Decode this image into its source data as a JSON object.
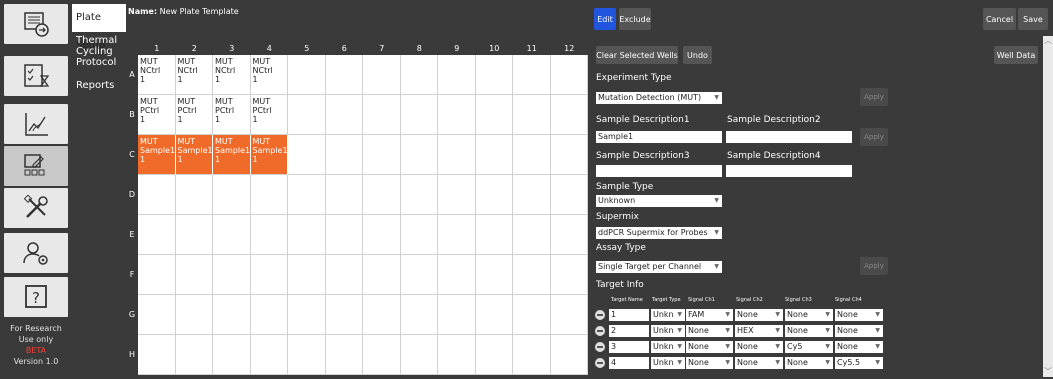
{
  "rail": {
    "nav_icons": [
      "plate-file-icon",
      "checklist-timer-icon",
      "line-chart-icon",
      "edit-plate-icon",
      "tools-icon",
      "users-settings-icon",
      "help-icon"
    ],
    "footer_line1": "For Research",
    "footer_line2": "Use only",
    "beta": "BETA",
    "version": "Version 1.0"
  },
  "menu": {
    "items": [
      "Plate Setup",
      "Thermal Cycling Protocol",
      "Reports"
    ],
    "active": "Plate Setup"
  },
  "plate": {
    "name_label": "Name:",
    "name_value": "New Plate Template",
    "columns": [
      "1",
      "2",
      "3",
      "4",
      "5",
      "6",
      "7",
      "8",
      "9",
      "10",
      "11",
      "12"
    ],
    "rows": [
      "A",
      "B",
      "C",
      "D",
      "E",
      "F",
      "G",
      "H"
    ],
    "wells": [
      {
        "row": "A",
        "col": "1",
        "line1": "MUT",
        "line2": "NCtrl",
        "line3": "1",
        "selected": false
      },
      {
        "row": "A",
        "col": "2",
        "line1": "MUT",
        "line2": "NCtrl",
        "line3": "1",
        "selected": false
      },
      {
        "row": "A",
        "col": "3",
        "line1": "MUT",
        "line2": "NCtrl",
        "line3": "1",
        "selected": false
      },
      {
        "row": "A",
        "col": "4",
        "line1": "MUT",
        "line2": "NCtrl",
        "line3": "1",
        "selected": false
      },
      {
        "row": "B",
        "col": "1",
        "line1": "MUT",
        "line2": "PCtrl",
        "line3": "1",
        "selected": false
      },
      {
        "row": "B",
        "col": "2",
        "line1": "MUT",
        "line2": "PCtrl",
        "line3": "1",
        "selected": false
      },
      {
        "row": "B",
        "col": "3",
        "line1": "MUT",
        "line2": "PCtrl",
        "line3": "1",
        "selected": false
      },
      {
        "row": "B",
        "col": "4",
        "line1": "MUT",
        "line2": "PCtrl",
        "line3": "1",
        "selected": false
      },
      {
        "row": "C",
        "col": "1",
        "line1": "MUT",
        "line2": "Sample1",
        "line3": "1",
        "selected": true
      },
      {
        "row": "C",
        "col": "2",
        "line1": "MUT",
        "line2": "Sample1",
        "line3": "1",
        "selected": true
      },
      {
        "row": "C",
        "col": "3",
        "line1": "MUT",
        "line2": "Sample1",
        "line3": "1",
        "selected": true
      },
      {
        "row": "C",
        "col": "4",
        "line1": "MUT",
        "line2": "Sample1",
        "line3": "1",
        "selected": true
      }
    ],
    "selected_color": "#f06a2a"
  },
  "toolbar": {
    "edit": "Edit",
    "exclude": "Exclude",
    "cancel": "Cancel",
    "save": "Save",
    "clear_selected": "Clear Selected Wells",
    "undo": "Undo",
    "well_data": "Well Data"
  },
  "form": {
    "experiment_type_label": "Experiment Type",
    "experiment_type_value": "Mutation Detection (MUT)",
    "apply": "Apply",
    "desc1_label": "Sample Description1",
    "desc1_value": "Sample1",
    "desc2_label": "Sample Description2",
    "desc2_value": "",
    "desc3_label": "Sample Description3",
    "desc3_value": "",
    "desc4_label": "Sample Description4",
    "desc4_value": "",
    "sample_type_label": "Sample Type",
    "sample_type_value": "Unknown",
    "supermix_label": "Supermix",
    "supermix_value": "ddPCR Supermix for Probes",
    "assay_type_label": "Assay Type",
    "assay_type_value": "Single Target per Channel",
    "target_info_label": "Target Info"
  },
  "targets": {
    "headers": [
      "Target Name",
      "Target Type",
      "Signal Ch1",
      "Signal Ch2",
      "Signal Ch3",
      "Signal Ch4"
    ],
    "rows": [
      {
        "name": "1",
        "type": "Unkn",
        "ch1": "FAM",
        "ch2": "None",
        "ch3": "None",
        "ch4": "None"
      },
      {
        "name": "2",
        "type": "Unkn",
        "ch1": "None",
        "ch2": "HEX",
        "ch3": "None",
        "ch4": "None"
      },
      {
        "name": "3",
        "type": "Unkn",
        "ch1": "None",
        "ch2": "None",
        "ch3": "Cy5",
        "ch4": "None"
      },
      {
        "name": "4",
        "type": "Unkn",
        "ch1": "None",
        "ch2": "None",
        "ch3": "None",
        "ch4": "Cy5.5"
      }
    ]
  },
  "colors": {
    "edit_accent": "#2255dd",
    "panel_bg": "#3a3a3a"
  }
}
